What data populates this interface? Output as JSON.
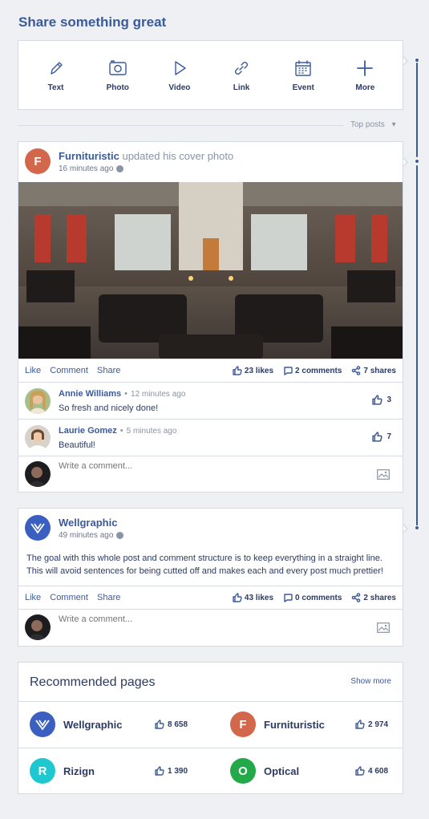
{
  "header": {
    "title": "Share something great"
  },
  "composer": {
    "items": [
      {
        "label": "Text",
        "icon": "pencil-icon"
      },
      {
        "label": "Photo",
        "icon": "camera-icon"
      },
      {
        "label": "Video",
        "icon": "play-icon"
      },
      {
        "label": "Link",
        "icon": "link-icon"
      },
      {
        "label": "Event",
        "icon": "calendar-icon"
      },
      {
        "label": "More",
        "icon": "plus-icon"
      }
    ]
  },
  "feed": {
    "sort_label": "Top posts"
  },
  "post1": {
    "initial": "F",
    "author": "Furnituristic",
    "activity": "updated his cover photo",
    "time": "16 minutes ago",
    "actions": {
      "like": "Like",
      "comment": "Comment",
      "share": "Share"
    },
    "stats": {
      "likes": "23 likes",
      "comments": "2 comments",
      "shares": "7 shares"
    },
    "comments": [
      {
        "name": "Annie Williams",
        "time": "12 minutes ago",
        "text": "So fresh and nicely done!",
        "likes": "3"
      },
      {
        "name": "Laurie Gomez",
        "time": "5 minutes ago",
        "text": "Beautiful!",
        "likes": "7"
      }
    ],
    "write_placeholder": "Write a comment..."
  },
  "post2": {
    "author": "Wellgraphic",
    "time": "49 minutes ago",
    "body": "The goal with this whole post and comment structure is to keep everything in a straight line. This will avoid sentences for being cutted off and makes each and every post much prettier!",
    "actions": {
      "like": "Like",
      "comment": "Comment",
      "share": "Share"
    },
    "stats": {
      "likes": "43 likes",
      "comments": "0 comments",
      "shares": "2 shares"
    },
    "write_placeholder": "Write a comment..."
  },
  "recommended": {
    "title": "Recommended pages",
    "show_more": "Show more",
    "pages": [
      {
        "name": "Wellgraphic",
        "likes": "8 658",
        "initial": "",
        "color": "#3b5fc0"
      },
      {
        "name": "Furnituristic",
        "likes": "2 974",
        "initial": "F",
        "color": "#d2674b"
      },
      {
        "name": "Rizign",
        "likes": "1 390",
        "initial": "R",
        "color": "#1fc8d0"
      },
      {
        "name": "Optical",
        "likes": "4 608",
        "initial": "O",
        "color": "#23a84a"
      }
    ]
  }
}
